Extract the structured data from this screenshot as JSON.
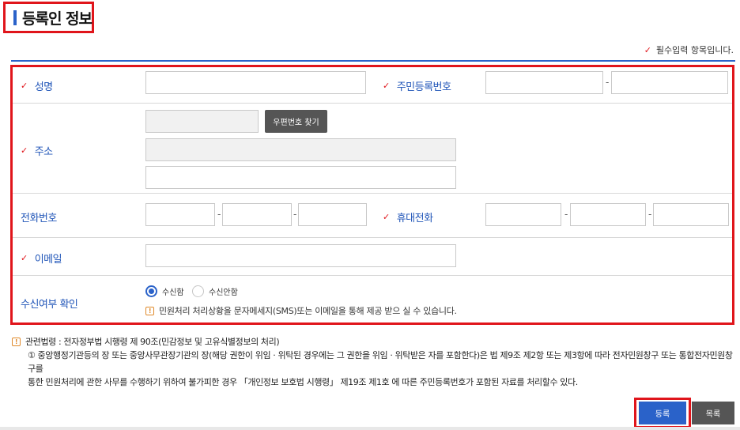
{
  "section": {
    "title": "등록인 정보"
  },
  "required_note": "필수입력 항목입니다.",
  "form": {
    "name_label": "성명",
    "rrn_label": "주민등록번호",
    "address_label": "주소",
    "zip_button": "우편번호 찾기",
    "phone_label": "전화번호",
    "mobile_label": "휴대전화",
    "email_label": "이메일",
    "receive_label": "수신여부 확인",
    "dash": "-",
    "receive_options": [
      {
        "label": "수신함",
        "selected": true
      },
      {
        "label": "수신안함",
        "selected": false
      }
    ],
    "sms_note": "민원처리 처리상황을 문자메세지(SMS)또는 이메일을 통해 제공 받으 실 수 있습니다."
  },
  "law": {
    "head": "관련법령 : 전자정부법 시행령 제 90조(민감정보 및 고유식별정보의 처리)",
    "line1": "① 중앙행정기관등의 장 또는 중앙사무관장기관의 장(해당 권한이 위임 · 위탁된 경우에는 그 권한을 위임 · 위탁받은 자를 포함한다)은 법 제9조 제2항 또는 제3항에 따라 전자민원창구 또는 통합전자민원창구를",
    "line2": "통한 민원처리에 관한 사무를 수행하기 위하여 불가피한 경우 「개인정보 보호법 시행령」 제19조 제1호 에 따른 주민등록번호가 포함된 자료를 처리할수 있다."
  },
  "buttons": {
    "register": "등록",
    "list": "목록"
  },
  "colors": {
    "accent": "#2a62c9",
    "highlight": "#e0151b",
    "label": "#2055b8"
  },
  "icons": {
    "check": "✓",
    "info": "!"
  }
}
